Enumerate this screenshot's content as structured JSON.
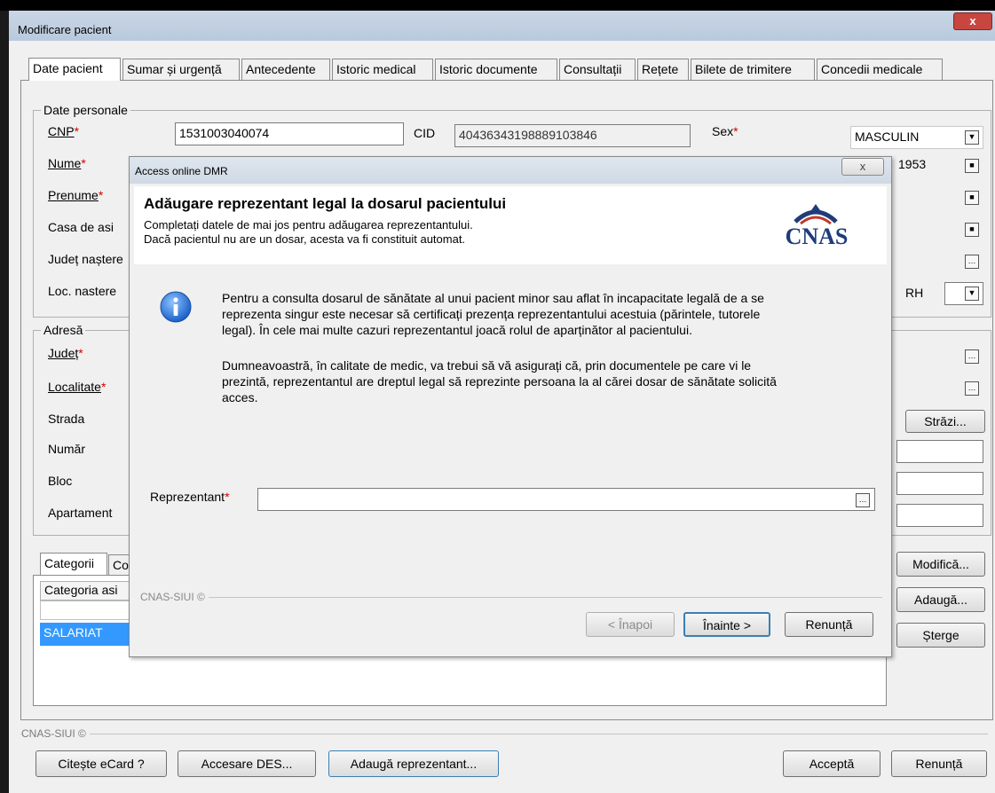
{
  "window": {
    "title": "Modificare pacient",
    "close_glyph": "x"
  },
  "tabs": [
    "Date pacient",
    "Sumar și urgență",
    "Antecedente",
    "Istoric medical",
    "Istoric documente",
    "Consultații",
    "Rețete",
    "Bilete de trimitere",
    "Concedii medicale"
  ],
  "personal": {
    "legend": "Date personale",
    "cnp_label": "CNP",
    "cnp_value": "1531003040074",
    "cid_label": "CID",
    "cid_value": "40436343198889103846",
    "sex_label": "Sex",
    "sex_value": "MASCULIN",
    "nume_label": "Nume",
    "birth_year": "1953",
    "prenume_label": "Prenume",
    "casa_label": "Casa de asi",
    "judet_nastere_label": "Județ naștere",
    "loc_nastere_label": "Loc. nastere",
    "rh_label": "RH",
    "required_mark": "*"
  },
  "address": {
    "legend": "Adresă",
    "judet_label": "Județ",
    "localitate_label": "Localitate",
    "strada_label": "Strada",
    "numar_label": "Număr",
    "bloc_label": "Bloc",
    "apartament_label": "Apartament",
    "strazi_button": "Străzi..."
  },
  "categories": {
    "tab_label": "Categorii",
    "tab2_partial": "Co",
    "column_header": "Categoria asi",
    "row_value": "SALARIAT",
    "modifica_button": "Modifică...",
    "adauga_button": "Adaugă...",
    "sterge_button": "Șterge"
  },
  "footer": {
    "brand": "CNAS-SIUI ©",
    "citeste_button": "Citește eCard ?",
    "accesare_button": "Accesare DES...",
    "adauga_repr_button": "Adaugă reprezentant...",
    "accepta_button": "Acceptă",
    "renunta_button": "Renunță"
  },
  "dialog": {
    "title": "Access online DMR",
    "close_glyph": "x",
    "heading": "Adăugare reprezentant legal la dosarul pacientului",
    "subtitle1": "Completați datele de mai jos pentru adăugarea reprezentantului.",
    "subtitle2": "Dacă pacientul nu are un dosar, acesta va fi constituit automat.",
    "logo_text": "CNAS",
    "info_p1_l1": "Pentru a consulta dosarul de sănătate al unui pacient minor sau aflat în incapacitate legală de a se",
    "info_p1_l2": "reprezenta singur este necesar să certificați prezența reprezentantului acestuia (părintele, tutorele",
    "info_p1_l3": "legal). În cele mai multe cazuri reprezentantul joacă rolul de aparținător al pacientului.",
    "info_p2_l1": "Dumneavoastră, în calitate de medic, va trebui să vă asigurați că, prin documentele pe care vi le",
    "info_p2_l2": "prezintă, reprezentantul are dreptul legal să reprezinte persoana la al cărei dosar de sănătate solicită",
    "info_p2_l3": "acces.",
    "repr_label": "Reprezentant",
    "repr_value": "",
    "brand": "CNAS-SIUI ©",
    "back_button": "< Înapoi",
    "next_button": "Înainte >",
    "cancel_button": "Renunță"
  },
  "icons": {
    "info": "info-icon",
    "logo": "cnas-logo"
  },
  "colors": {
    "selected_row": "#3399ff",
    "required": "#d40000",
    "titlebar": "#c9d6e6"
  }
}
